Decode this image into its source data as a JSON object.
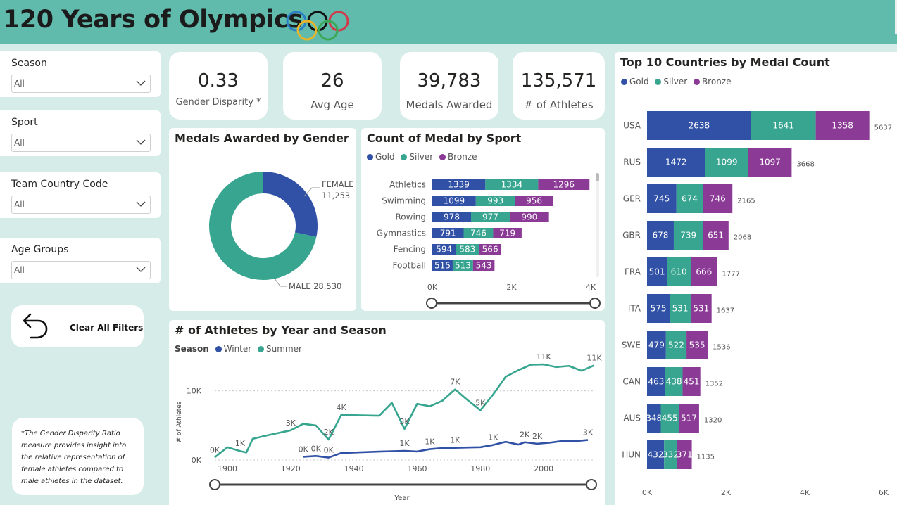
{
  "header": {
    "title": "120 Years of Olympics",
    "logo": "olympic-rings"
  },
  "colors": {
    "gold": "#3051a5",
    "silver": "#37a58f",
    "bronze": "#8b3a96",
    "winter": "#3051a5",
    "summer": "#37a58f",
    "header": "#61bbac",
    "background": "#d6ece8"
  },
  "slicers": [
    {
      "label": "Season",
      "value": "All"
    },
    {
      "label": "Sport",
      "value": "All"
    },
    {
      "label": "Team Country Code",
      "value": "All"
    },
    {
      "label": "Age Groups",
      "value": "All"
    }
  ],
  "clear_filters": {
    "label": "Clear All Filters",
    "icon": "undo-arrow-icon"
  },
  "note": "*The Gender Disparity Ratio measure provides insight into the relative representation of female athletes compared to male athletes in the dataset.",
  "kpis": [
    {
      "value": "0.33",
      "label": "Gender Disparity *"
    },
    {
      "value": "26",
      "label": "Avg Age"
    },
    {
      "value": "39,783",
      "label": "Medals Awarded"
    },
    {
      "value": "135,571",
      "label": "# of Athletes"
    }
  ],
  "chart_data": [
    {
      "id": "gender",
      "type": "pie",
      "subtype": "donut",
      "title": "Medals Awarded by Gender",
      "slices": [
        {
          "label": "FEMALE",
          "value": 11253,
          "value_label": "11,253"
        },
        {
          "label": "MALE",
          "value": 28530,
          "value_label": "28,530"
        }
      ]
    },
    {
      "id": "sport",
      "type": "bar",
      "orientation": "horizontal",
      "stacked": true,
      "title": "Count of Medal by Sport",
      "categories": [
        "Athletics",
        "Swimming",
        "Rowing",
        "Gymnastics",
        "Fencing",
        "Football"
      ],
      "series": [
        {
          "name": "Gold",
          "values": [
            1339,
            1099,
            978,
            791,
            594,
            515
          ]
        },
        {
          "name": "Silver",
          "values": [
            1334,
            993,
            977,
            746,
            583,
            513
          ]
        },
        {
          "name": "Bronze",
          "values": [
            1296,
            956,
            990,
            719,
            566,
            543
          ]
        }
      ],
      "xlim": [
        0,
        4000
      ],
      "xticks": [
        "0K",
        "2K",
        "4K"
      ]
    },
    {
      "id": "countries",
      "type": "bar",
      "orientation": "horizontal",
      "stacked": true,
      "title": "Top 10 Countries by Medal Count",
      "categories": [
        "USA",
        "RUS",
        "GER",
        "GBR",
        "FRA",
        "ITA",
        "SWE",
        "CAN",
        "AUS",
        "HUN"
      ],
      "series": [
        {
          "name": "Gold",
          "values": [
            2638,
            1472,
            745,
            678,
            501,
            575,
            479,
            463,
            348,
            432
          ]
        },
        {
          "name": "Silver",
          "values": [
            1641,
            1099,
            674,
            739,
            610,
            531,
            522,
            438,
            455,
            332
          ]
        },
        {
          "name": "Bronze",
          "values": [
            1358,
            1097,
            746,
            651,
            666,
            531,
            535,
            451,
            517,
            371
          ]
        }
      ],
      "totals": [
        5637,
        3668,
        2165,
        2068,
        1777,
        1637,
        1536,
        1352,
        1320,
        1135
      ],
      "xlim": [
        0,
        6000
      ],
      "xticks": [
        "0K",
        "2K",
        "4K",
        "6K"
      ]
    },
    {
      "id": "athletes",
      "type": "line",
      "title": "# of Athletes by Year and Season",
      "legend_title": "Season",
      "xlabel": "Year",
      "ylabel": "# of Athletes",
      "xlim": [
        1896,
        2016
      ],
      "ylim": [
        0,
        12000
      ],
      "xticks": [
        "1900",
        "1920",
        "1940",
        "1960",
        "1980",
        "2000"
      ],
      "yticks": [
        "0K",
        "10K"
      ],
      "series": [
        {
          "name": "Winter",
          "x": [
            1924,
            1928,
            1932,
            1936,
            1948,
            1952,
            1956,
            1960,
            1964,
            1968,
            1972,
            1976,
            1980,
            1984,
            1988,
            1992,
            1994,
            1998,
            2002,
            2006,
            2010,
            2014
          ],
          "y": [
            460,
            582,
            352,
            1012,
            1210,
            1270,
            1320,
            1230,
            1570,
            1730,
            1760,
            1810,
            1850,
            2170,
            2630,
            2230,
            2570,
            2350,
            2510,
            2750,
            2730,
            2890
          ]
        },
        {
          "name": "Summer",
          "x": [
            1896,
            1900,
            1904,
            1906,
            1908,
            1912,
            1920,
            1924,
            1928,
            1932,
            1936,
            1948,
            1952,
            1956,
            1960,
            1964,
            1968,
            1972,
            1976,
            1980,
            1984,
            1988,
            1992,
            1996,
            2000,
            2004,
            2008,
            2012,
            2016
          ],
          "y": [
            380,
            1840,
            1300,
            1080,
            3060,
            3500,
            4290,
            5230,
            4990,
            2950,
            6510,
            6400,
            8270,
            4490,
            8120,
            7760,
            8580,
            10200,
            8640,
            7190,
            9450,
            12040,
            12980,
            13780,
            13820,
            13440,
            13600,
            12900,
            13690
          ]
        }
      ],
      "data_labels": [
        {
          "text": "0K",
          "series": "Summer",
          "x": 1896
        },
        {
          "text": "1K",
          "series": "Summer",
          "x": 1904
        },
        {
          "text": "3K",
          "series": "Summer",
          "x": 1920
        },
        {
          "text": "2K",
          "series": "Summer",
          "x": 1932
        },
        {
          "text": "4K",
          "series": "Summer",
          "x": 1936
        },
        {
          "text": "3K",
          "series": "Summer",
          "x": 1956
        },
        {
          "text": "7K",
          "series": "Summer",
          "x": 1972
        },
        {
          "text": "5K",
          "series": "Summer",
          "x": 1980
        },
        {
          "text": "11K",
          "series": "Summer",
          "x": 2000
        },
        {
          "text": "11K",
          "series": "Summer",
          "x": 2016
        },
        {
          "text": "0K",
          "series": "Winter",
          "x": 1924
        },
        {
          "text": "0K",
          "series": "Winter",
          "x": 1928
        },
        {
          "text": "0K",
          "series": "Winter",
          "x": 1932
        },
        {
          "text": "1K",
          "series": "Winter",
          "x": 1956
        },
        {
          "text": "1K",
          "series": "Winter",
          "x": 1964
        },
        {
          "text": "1K",
          "series": "Winter",
          "x": 1972
        },
        {
          "text": "1K",
          "series": "Winter",
          "x": 1984
        },
        {
          "text": "2K",
          "series": "Winter",
          "x": 1994
        },
        {
          "text": "2K",
          "series": "Winter",
          "x": 1998
        },
        {
          "text": "3K",
          "series": "Winter",
          "x": 2014
        }
      ]
    }
  ]
}
